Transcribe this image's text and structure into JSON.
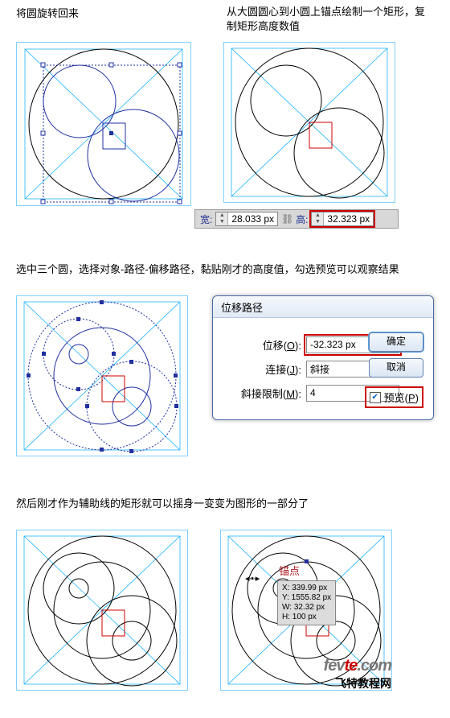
{
  "step1": {
    "left_caption": "将圆旋转回来",
    "right_caption": "从大圆圆心到小圆上锚点绘制一个矩形，复制矩形高度数值"
  },
  "wh_bar": {
    "w_label": "宽:",
    "w_value": "28.033 px",
    "link_icon": "link-icon",
    "h_label": "高:",
    "h_value": "32.323 px"
  },
  "step2": {
    "caption": "选中三个圆，选择对象-路径-偏移路径，黏贴刚才的高度值，勾选预览可以观察结果"
  },
  "dialog": {
    "title": "位移路径",
    "offset_label_pre": "位移(",
    "offset_hotkey": "O",
    "offset_label_post": "):",
    "offset_value": "-32.323 px",
    "join_label_pre": "连接(",
    "join_hotkey": "J",
    "join_label_post": "):",
    "join_value": "斜接",
    "miter_label_pre": "斜接限制(",
    "miter_hotkey": "M",
    "miter_label_post": "):",
    "miter_value": "4",
    "ok": "确定",
    "cancel": "取消",
    "preview_hotkey": "P",
    "preview": "预览(",
    "preview_post": ")"
  },
  "step3": {
    "caption": "然后刚才作为辅助线的矩形就可以摇身一变变为图形的一部分了"
  },
  "anchor": {
    "label": "锚点",
    "x": "X: 339.99 px",
    "y": "Y: 1555.82 px",
    "w": "W: 32.32 px",
    "h": "H: 100 px"
  },
  "footer": {
    "brand_grey": "fev",
    "brand_red": "te",
    "brand_dom": ".com",
    "tagline": "飞特教程网"
  }
}
